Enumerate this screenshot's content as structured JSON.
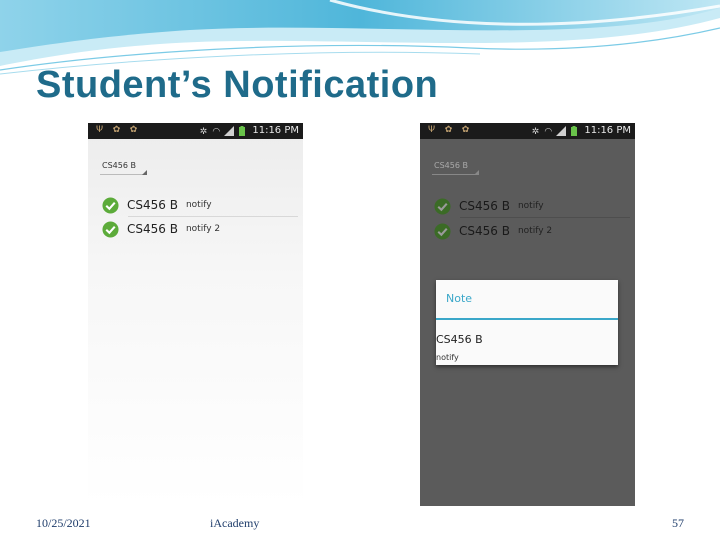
{
  "slide": {
    "title": "Student’s Notification",
    "date": "10/25/2021",
    "footer_center": "iAcademy",
    "page_number": "57"
  },
  "phone_left": {
    "status_time": "11:16 PM",
    "dropdown_label": "CS456 B",
    "notifications": [
      {
        "course": "CS456 B",
        "note": "notify"
      },
      {
        "course": "CS456 B",
        "note": "notify 2"
      }
    ]
  },
  "phone_right": {
    "status_time": "11:16 PM",
    "dropdown_label": "CS456 B",
    "notifications": [
      {
        "course": "CS456 B",
        "note": "notify"
      },
      {
        "course": "CS456 B",
        "note": "notify 2"
      }
    ],
    "dialog": {
      "title": "Note",
      "course": "CS456 B",
      "note": "notify"
    }
  },
  "colors": {
    "title": "#1f6b8a",
    "accent": "#3aa7c9",
    "check_green": "#5cab3a",
    "dim_overlay": "#5b5b5b"
  }
}
